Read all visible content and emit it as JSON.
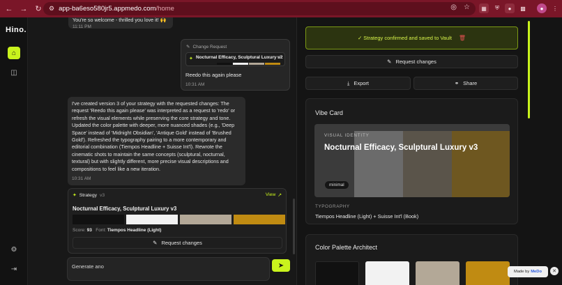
{
  "browser": {
    "url_host": "app-ba6eso580jr5.appmedo.com",
    "url_path": "/home"
  },
  "app": {
    "logo": "Hino."
  },
  "chat": {
    "prev_message_tail": "You're so welcome - thrilled you love it! 🙌",
    "prev_message_time": "11:11 PM",
    "change_request": {
      "header": "Change Request",
      "strategy_name": "Nocturnal Efficacy, Sculptural Luxury v2",
      "version_badge": "v2",
      "message": "Reedo this again please",
      "time": "10:31 AM"
    },
    "assistant_message": "I've created version 3 of your strategy with the requested changes: The request 'Reedo this again please' was interpreted as a request to 'redo' or refresh the visual elements while preserving the core strategy and tone. Updated the color palette with deeper, more nuanced shades (e.g., 'Deep Space' instead of 'Midnight Obsidian', 'Antique Gold' instead of 'Brushed Gold'). Refreshed the typography pairing to a more contemporary and editorial combination (Tiempos Headline + Suisse Int'l). Rewrote the cinematic shots to maintain the same concepts (sculptural, nocturnal, textural) but with slightly different, more precise visual descriptions and compositions to feel like a new iteration.",
    "assistant_time": "10:31 AM",
    "strategy_card": {
      "label": "Strategy",
      "version": "v3",
      "view_label": "View",
      "name": "Nocturnal Efficacy, Sculptural Luxury v3",
      "score_label": "Score:",
      "score": "93",
      "font_label": "Font:",
      "font": "Tiempos Headline (Light)",
      "request_changes": "Request changes",
      "swatches": [
        "#111111",
        "#f2f2f2",
        "#b3a897",
        "#c08b12"
      ]
    },
    "input_value": "Generate ano"
  },
  "panel": {
    "confirm_text": "✓ Strategy confirmed and saved to Vault",
    "request_changes": "Request changes",
    "export": "Export",
    "share": "Share",
    "vibe_card": {
      "title": "Vibe Card",
      "eyebrow": "VISUAL IDENTITY",
      "headline": "Nocturnal Efficacy, Sculptural Luxury v3",
      "pill": "minimal",
      "typography_label": "TYPOGRAPHY",
      "typography_value": "Tiempos Headline (Light) + Suisse Int'l (Book)"
    },
    "palette": {
      "title": "Color Palette Architect",
      "colors": [
        "#111111",
        "#f2f2f2",
        "#b3a897",
        "#c08b12"
      ]
    }
  },
  "badge": {
    "made_by": "Made by",
    "brand": "MeDo"
  },
  "colors": {
    "accent": "#c9f31d",
    "danger": "#e05050"
  }
}
